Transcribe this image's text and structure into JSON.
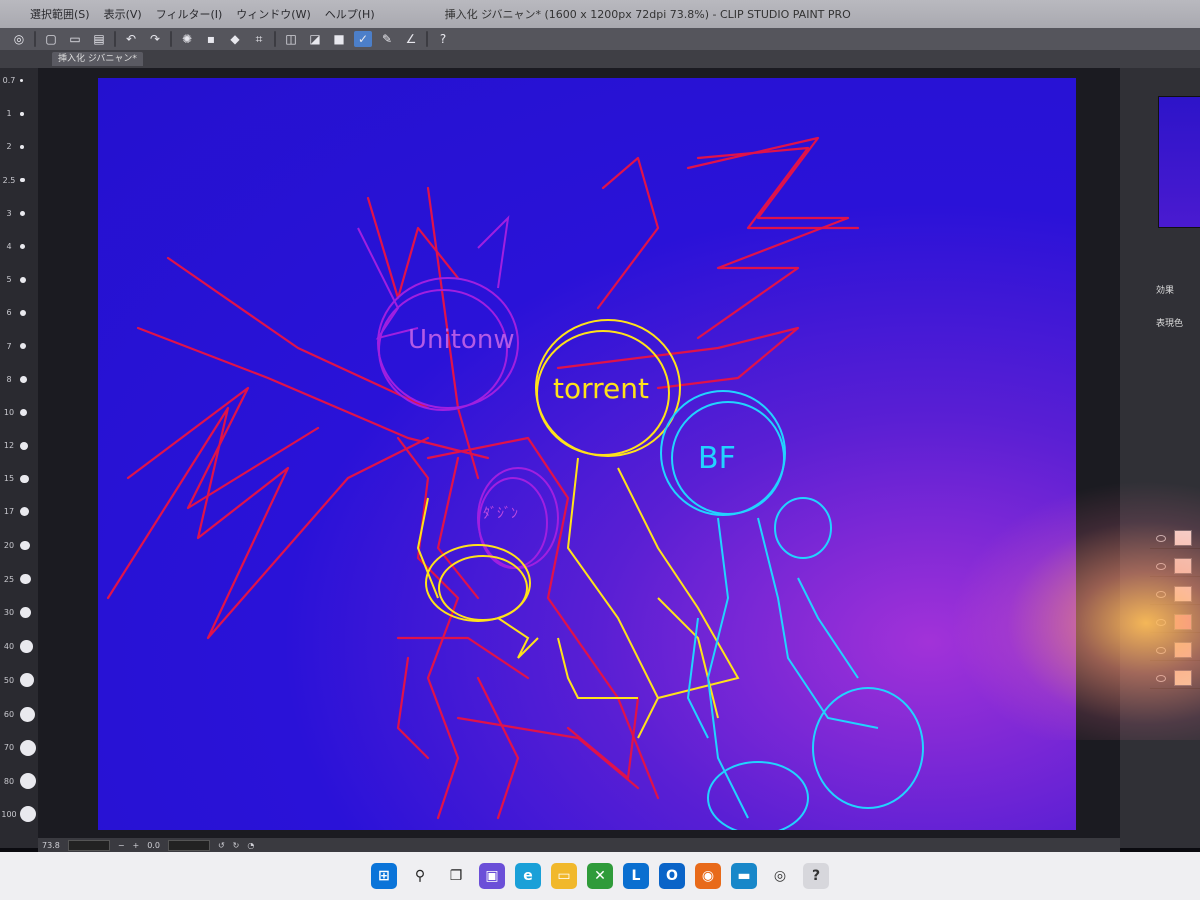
{
  "window": {
    "title": "挿入化 ジバニャン* (1600 x 1200px 72dpi 73.8%) - CLIP STUDIO PAINT PRO",
    "menu": [
      "選択範囲(S)",
      "表示(V)",
      "フィルター(I)",
      "ウィンドウ(W)",
      "ヘルプ(H)"
    ]
  },
  "document_tab": {
    "label": "挿入化 ジバニャン*"
  },
  "brush_sizes": [
    "0.7",
    "1",
    "2",
    "2.5",
    "3",
    "4",
    "5",
    "6",
    "7",
    "8",
    "10",
    "12",
    "15",
    "17",
    "20",
    "25",
    "30",
    "40",
    "50",
    "60",
    "70",
    "80",
    "100"
  ],
  "canvas_text": {
    "purple_head": "Unitonw",
    "yellow_head": "torrent",
    "cyan_head": "BF",
    "small_head": "ﾀﾞｼﾞﾝ"
  },
  "status_bar": {
    "zoom": "73.8",
    "rotation": "0.0"
  },
  "right_panel": {
    "effect_label": "効果",
    "expression_label": "表現色"
  },
  "colors": {
    "canvas_blue": "#2411cf",
    "stroke_red": "#e0124a",
    "stroke_purple": "#a01fe0",
    "stroke_yellow": "#ffe21a",
    "stroke_cyan": "#22d3ff"
  },
  "taskbar_icons": [
    "windows-start-icon",
    "search-icon",
    "task-view-icon",
    "chat-icon",
    "edge-icon",
    "file-explorer-icon",
    "xbox-icon",
    "l-app-icon",
    "outlook-icon",
    "firefox-icon",
    "monitor-icon",
    "clip-studio-icon",
    "clip-studio-paint-icon"
  ]
}
